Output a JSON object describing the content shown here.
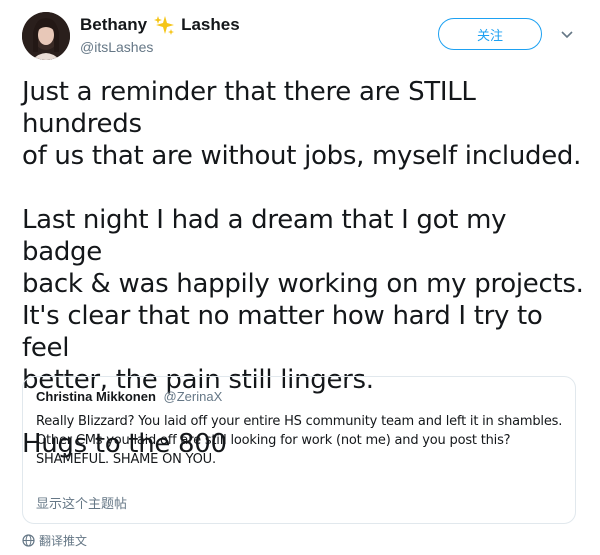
{
  "author": {
    "display_name_first": "Bethany",
    "display_name_last": "Lashes",
    "emoji_icon": "sparkles-icon",
    "handle": "@itsLashes",
    "avatar_icon": "user-avatar"
  },
  "follow_button": {
    "label": "关注",
    "accent_color": "#1da1f2"
  },
  "menu": {
    "icon": "chevron-down-icon"
  },
  "tweet": {
    "paragraphs": [
      "Just a reminder that there are STILL hundreds\nof us that are without jobs, myself included.",
      "Last night I had a dream that I got my badge\nback & was happily working on my projects.\nIt's clear that no matter how hard I try to feel\nbetter, the pain still lingers.",
      "Hugs to the 800"
    ]
  },
  "quoted_tweet": {
    "name": "Christina Mikkonen",
    "handle": "@ZerinaX",
    "text": "Really Blizzard? You laid off your entire HS community team and left it in shambles.\nOther CMs you laid off are still looking for work (not me) and you post this?\nSHAMEFUL. SHAME ON YOU.",
    "show_thread_label": "显示这个主题帖"
  },
  "translate": {
    "icon": "globe-icon",
    "label": "翻译推文"
  }
}
